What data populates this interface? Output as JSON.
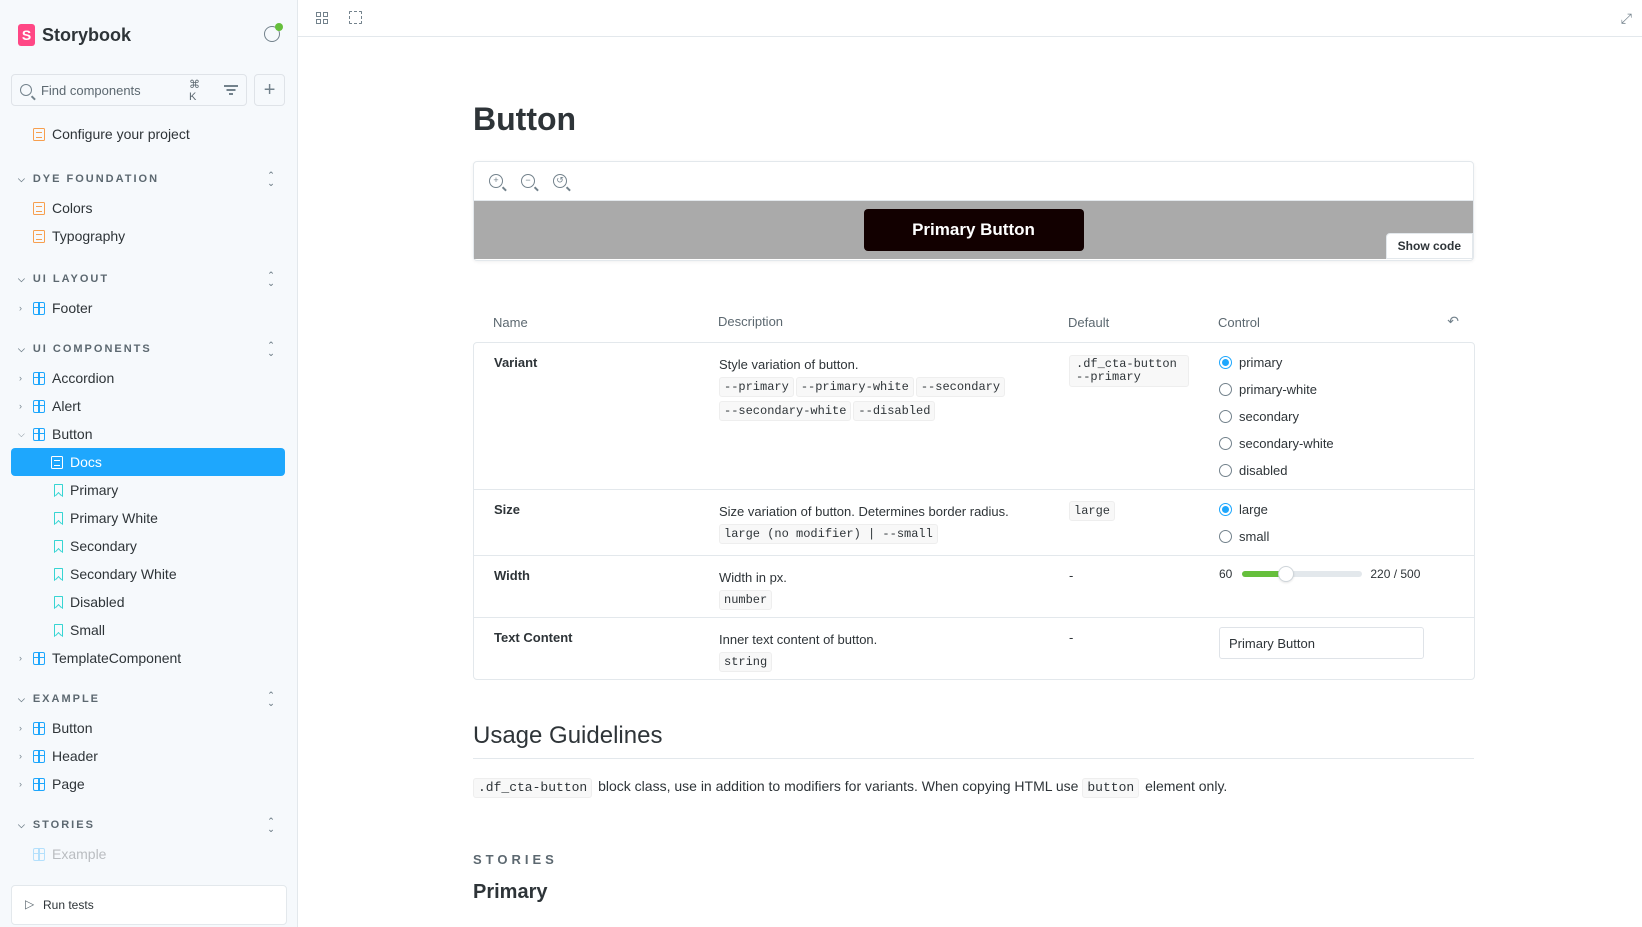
{
  "brand": {
    "name": "Storybook",
    "logo_letter": "S"
  },
  "search": {
    "placeholder": "Find components",
    "shortcut": "⌘ K"
  },
  "sidebar": {
    "top_item": "Configure your project",
    "groups": [
      {
        "label": "DYE FOUNDATION",
        "items": [
          "Colors",
          "Typography"
        ]
      },
      {
        "label": "UI LAYOUT",
        "items": [
          "Footer"
        ]
      },
      {
        "label": "UI COMPONENTS",
        "items": [
          "Accordion",
          "Alert",
          "Button",
          "Docs",
          "Primary",
          "Primary White",
          "Secondary",
          "Secondary White",
          "Disabled",
          "Small",
          "TemplateComponent"
        ]
      },
      {
        "label": "EXAMPLE",
        "items": [
          "Button",
          "Header",
          "Page"
        ]
      },
      {
        "label": "STORIES",
        "items": [
          "Example"
        ]
      }
    ],
    "run_tests": "Run tests"
  },
  "page": {
    "title": "Button",
    "preview_button": "Primary Button",
    "show_code": "Show code"
  },
  "argtable": {
    "headers": [
      "Name",
      "Description",
      "Default",
      "Control"
    ],
    "rows": [
      {
        "name": "Variant",
        "description": "Style variation of button.",
        "codes": [
          "--primary",
          "--primary-white",
          "--secondary",
          "--secondary-white",
          "--disabled"
        ],
        "default": ".df_cta-button--primary",
        "options": [
          "primary",
          "primary-white",
          "secondary",
          "secondary-white",
          "disabled"
        ],
        "selected": "primary"
      },
      {
        "name": "Size",
        "description": "Size variation of button. Determines border radius.",
        "codes": [
          "large (no modifier) | --small"
        ],
        "default": "large",
        "options": [
          "large",
          "small"
        ],
        "selected": "large"
      },
      {
        "name": "Width",
        "description": "Width in px.",
        "codes": [
          "number"
        ],
        "default": "-",
        "slider": {
          "min": "60",
          "value": 220,
          "max_label": "220 / 500",
          "max": 500
        }
      },
      {
        "name": "Text Content",
        "description": "Inner text content of button.",
        "codes": [
          "string"
        ],
        "default": "-",
        "text_value": "Primary Button"
      }
    ]
  },
  "usage": {
    "heading": "Usage Guidelines",
    "code1": ".df_cta-button",
    "text1": "block class, use in addition to modifiers for variants. When copying HTML use",
    "code2": "button",
    "text2": "element only."
  },
  "stories": {
    "label": "STORIES",
    "first": "Primary"
  },
  "colors": {
    "accent": "#1ea7fd",
    "brand": "#ff4785",
    "slider_fill": "#66bf3c"
  }
}
